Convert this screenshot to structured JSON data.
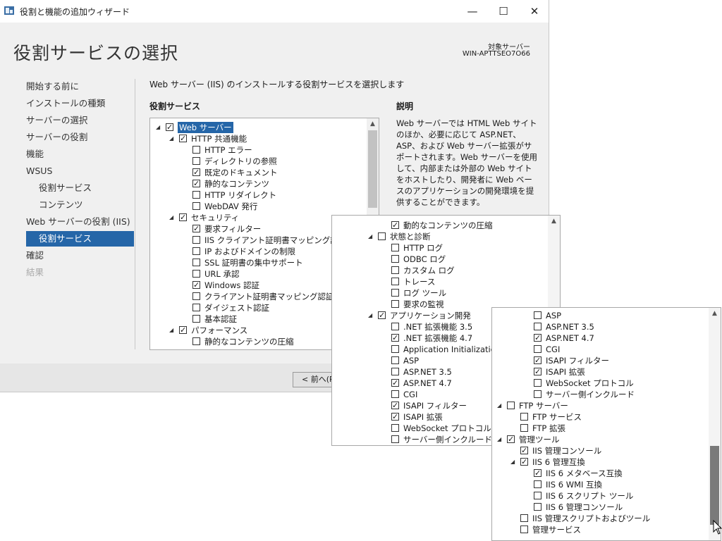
{
  "window": {
    "title": "役割と機能の追加ウィザード",
    "minimize": "—",
    "maximize": "☐",
    "close": "✕"
  },
  "header": {
    "page_title": "役割サービスの選択",
    "target_label": "対象サーバー",
    "target_server": "WIN-APTTSEO7O66"
  },
  "nav": {
    "items": [
      {
        "label": "開始する前に",
        "state": "normal"
      },
      {
        "label": "インストールの種類",
        "state": "normal"
      },
      {
        "label": "サーバーの選択",
        "state": "normal"
      },
      {
        "label": "サーバーの役割",
        "state": "normal"
      },
      {
        "label": "機能",
        "state": "normal"
      },
      {
        "label": "WSUS",
        "state": "normal"
      },
      {
        "label": "役割サービス",
        "state": "sub"
      },
      {
        "label": "コンテンツ",
        "state": "sub"
      },
      {
        "label": "Web サーバーの役割 (IIS)",
        "state": "normal"
      },
      {
        "label": "役割サービス",
        "state": "active"
      },
      {
        "label": "確認",
        "state": "normal"
      },
      {
        "label": "結果",
        "state": "disabled"
      }
    ]
  },
  "main": {
    "instruction": "Web サーバー (IIS) のインストールする役割サービスを選択します",
    "services_heading": "役割サービス",
    "description_heading": "説明",
    "description": "Web サーバーでは HTML Web サイトのほか、必要に応じて ASP.NET、ASP、および Web サーバー拡張がサポートされます。Web サーバーを使用して、内部または外部の Web サイトをホストしたり、開発者に Web ベースのアプリケーションの開発環境を提供することができます。",
    "prev_button": "< 前へ(P)"
  },
  "tree1": [
    {
      "level": 0,
      "expander": "◢",
      "checked": true,
      "label": "Web サーバー",
      "selected": true
    },
    {
      "level": 1,
      "expander": "◢",
      "checked": true,
      "label": "HTTP 共通機能"
    },
    {
      "level": 2,
      "expander": "",
      "checked": false,
      "label": "HTTP エラー"
    },
    {
      "level": 2,
      "expander": "",
      "checked": false,
      "label": "ディレクトリの参照"
    },
    {
      "level": 2,
      "expander": "",
      "checked": true,
      "label": "既定のドキュメント"
    },
    {
      "level": 2,
      "expander": "",
      "checked": true,
      "label": "静的なコンテンツ"
    },
    {
      "level": 2,
      "expander": "",
      "checked": false,
      "label": "HTTP リダイレクト"
    },
    {
      "level": 2,
      "expander": "",
      "checked": false,
      "label": "WebDAV 発行"
    },
    {
      "level": 1,
      "expander": "◢",
      "checked": true,
      "label": "セキュリティ"
    },
    {
      "level": 2,
      "expander": "",
      "checked": true,
      "label": "要求フィルター"
    },
    {
      "level": 2,
      "expander": "",
      "checked": false,
      "label": "IIS クライアント証明書マッピング認証"
    },
    {
      "level": 2,
      "expander": "",
      "checked": false,
      "label": "IP およびドメインの制限"
    },
    {
      "level": 2,
      "expander": "",
      "checked": false,
      "label": "SSL 証明書の集中サポート"
    },
    {
      "level": 2,
      "expander": "",
      "checked": false,
      "label": "URL 承認"
    },
    {
      "level": 2,
      "expander": "",
      "checked": true,
      "label": "Windows 認証"
    },
    {
      "level": 2,
      "expander": "",
      "checked": false,
      "label": "クライアント証明書マッピング認証"
    },
    {
      "level": 2,
      "expander": "",
      "checked": false,
      "label": "ダイジェスト認証"
    },
    {
      "level": 2,
      "expander": "",
      "checked": false,
      "label": "基本認証"
    },
    {
      "level": 1,
      "expander": "◢",
      "checked": true,
      "label": "パフォーマンス"
    },
    {
      "level": 2,
      "expander": "",
      "checked": false,
      "label": "静的なコンテンツの圧縮"
    }
  ],
  "tree2": [
    {
      "level": 2,
      "expander": "",
      "checked": true,
      "label": "動的なコンテンツの圧縮"
    },
    {
      "level": 1,
      "expander": "◢",
      "checked": false,
      "label": "状態と診断"
    },
    {
      "level": 2,
      "expander": "",
      "checked": false,
      "label": "HTTP ログ"
    },
    {
      "level": 2,
      "expander": "",
      "checked": false,
      "label": "ODBC ログ"
    },
    {
      "level": 2,
      "expander": "",
      "checked": false,
      "label": "カスタム ログ"
    },
    {
      "level": 2,
      "expander": "",
      "checked": false,
      "label": "トレース"
    },
    {
      "level": 2,
      "expander": "",
      "checked": false,
      "label": "ログ ツール"
    },
    {
      "level": 2,
      "expander": "",
      "checked": false,
      "label": "要求の監視"
    },
    {
      "level": 1,
      "expander": "◢",
      "checked": true,
      "label": "アプリケーション開発"
    },
    {
      "level": 2,
      "expander": "",
      "checked": false,
      "label": ".NET 拡張機能 3.5"
    },
    {
      "level": 2,
      "expander": "",
      "checked": true,
      "label": ".NET 拡張機能 4.7"
    },
    {
      "level": 2,
      "expander": "",
      "checked": false,
      "label": "Application Initialization"
    },
    {
      "level": 2,
      "expander": "",
      "checked": false,
      "label": "ASP"
    },
    {
      "level": 2,
      "expander": "",
      "checked": false,
      "label": "ASP.NET 3.5"
    },
    {
      "level": 2,
      "expander": "",
      "checked": true,
      "label": "ASP.NET 4.7"
    },
    {
      "level": 2,
      "expander": "",
      "checked": false,
      "label": "CGI"
    },
    {
      "level": 2,
      "expander": "",
      "checked": true,
      "label": "ISAPI フィルター"
    },
    {
      "level": 2,
      "expander": "",
      "checked": true,
      "label": "ISAPI 拡張"
    },
    {
      "level": 2,
      "expander": "",
      "checked": false,
      "label": "WebSocket プロトコル"
    },
    {
      "level": 2,
      "expander": "",
      "checked": false,
      "label": "サーバー側インクルード"
    }
  ],
  "tree3": [
    {
      "level": 2,
      "expander": "",
      "checked": false,
      "label": "ASP"
    },
    {
      "level": 2,
      "expander": "",
      "checked": false,
      "label": "ASP.NET 3.5"
    },
    {
      "level": 2,
      "expander": "",
      "checked": true,
      "label": "ASP.NET 4.7"
    },
    {
      "level": 2,
      "expander": "",
      "checked": false,
      "label": "CGI"
    },
    {
      "level": 2,
      "expander": "",
      "checked": true,
      "label": "ISAPI フィルター"
    },
    {
      "level": 2,
      "expander": "",
      "checked": true,
      "label": "ISAPI 拡張"
    },
    {
      "level": 2,
      "expander": "",
      "checked": false,
      "label": "WebSocket プロトコル"
    },
    {
      "level": 2,
      "expander": "",
      "checked": false,
      "label": "サーバー側インクルード"
    },
    {
      "level": 0,
      "expander": "◢",
      "checked": false,
      "label": "FTP サーバー"
    },
    {
      "level": 1,
      "expander": "",
      "checked": false,
      "label": "FTP サービス"
    },
    {
      "level": 1,
      "expander": "",
      "checked": false,
      "label": "FTP 拡張"
    },
    {
      "level": 0,
      "expander": "◢",
      "checked": true,
      "label": "管理ツール"
    },
    {
      "level": 1,
      "expander": "",
      "checked": true,
      "label": "IIS 管理コンソール"
    },
    {
      "level": 1,
      "expander": "◢",
      "checked": true,
      "label": "IIS 6 管理互換"
    },
    {
      "level": 2,
      "expander": "",
      "checked": true,
      "label": "IIS 6 メタベース互換"
    },
    {
      "level": 2,
      "expander": "",
      "checked": false,
      "label": "IIS 6 WMI 互換"
    },
    {
      "level": 2,
      "expander": "",
      "checked": false,
      "label": "IIS 6 スクリプト ツール"
    },
    {
      "level": 2,
      "expander": "",
      "checked": false,
      "label": "IIS 6 管理コンソール"
    },
    {
      "level": 1,
      "expander": "",
      "checked": false,
      "label": "IIS 管理スクリプトおよびツール"
    },
    {
      "level": 1,
      "expander": "",
      "checked": false,
      "label": "管理サービス"
    }
  ],
  "scroll": {
    "up": "▲",
    "down": "▼",
    "tree1_position": 0.0,
    "tree3_position": 0.95
  },
  "colors": {
    "accent": "#2566a8",
    "window_bg": "#f0f0f0"
  }
}
